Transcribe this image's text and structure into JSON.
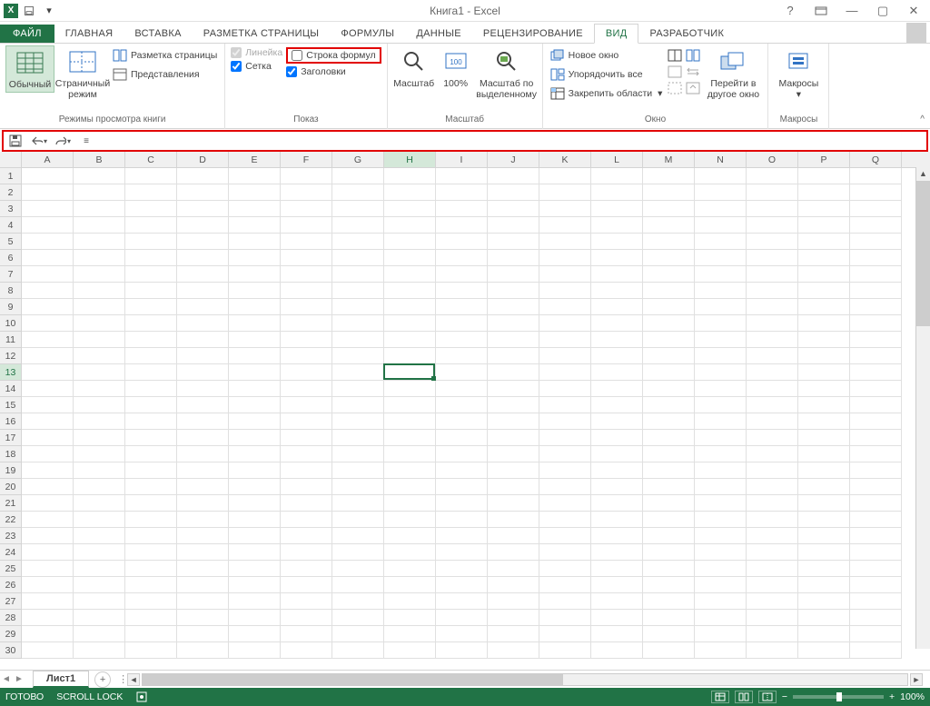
{
  "title": "Книга1 - Excel",
  "tabs": {
    "file": "ФАЙЛ",
    "home": "ГЛАВНАЯ",
    "insert": "ВСТАВКА",
    "pagelayout": "РАЗМЕТКА СТРАНИЦЫ",
    "formulas": "ФОРМУЛЫ",
    "data": "ДАННЫЕ",
    "review": "РЕЦЕНЗИРОВАНИЕ",
    "view": "ВИД",
    "developer": "РАЗРАБОТЧИК"
  },
  "ribbon": {
    "modes": {
      "normal": "Обычный",
      "pagebreak": "Страничный\nрежим",
      "pagelayout": "Разметка страницы",
      "custom": "Представления",
      "group": "Режимы просмотра книги"
    },
    "show": {
      "ruler": "Линейка",
      "formulabar": "Строка формул",
      "grid": "Сетка",
      "headings": "Заголовки",
      "group": "Показ"
    },
    "zoom": {
      "zoom": "Масштаб",
      "hundred": "100%",
      "selection": "Масштаб по\nвыделенному",
      "group": "Масштаб"
    },
    "window": {
      "new": "Новое окно",
      "arrange": "Упорядочить все",
      "freeze": "Закрепить области",
      "switch": "Перейти в\nдругое окно",
      "group": "Окно"
    },
    "macros": {
      "macros": "Макросы",
      "group": "Макросы"
    }
  },
  "columns": [
    "A",
    "B",
    "C",
    "D",
    "E",
    "F",
    "G",
    "H",
    "I",
    "J",
    "K",
    "L",
    "M",
    "N",
    "O",
    "P",
    "Q"
  ],
  "rows": 30,
  "active": {
    "col": "H",
    "row": 13
  },
  "sheet": {
    "name": "Лист1"
  },
  "status": {
    "ready": "ГОТОВО",
    "scroll": "SCROLL LOCK",
    "zoom": "100%"
  }
}
